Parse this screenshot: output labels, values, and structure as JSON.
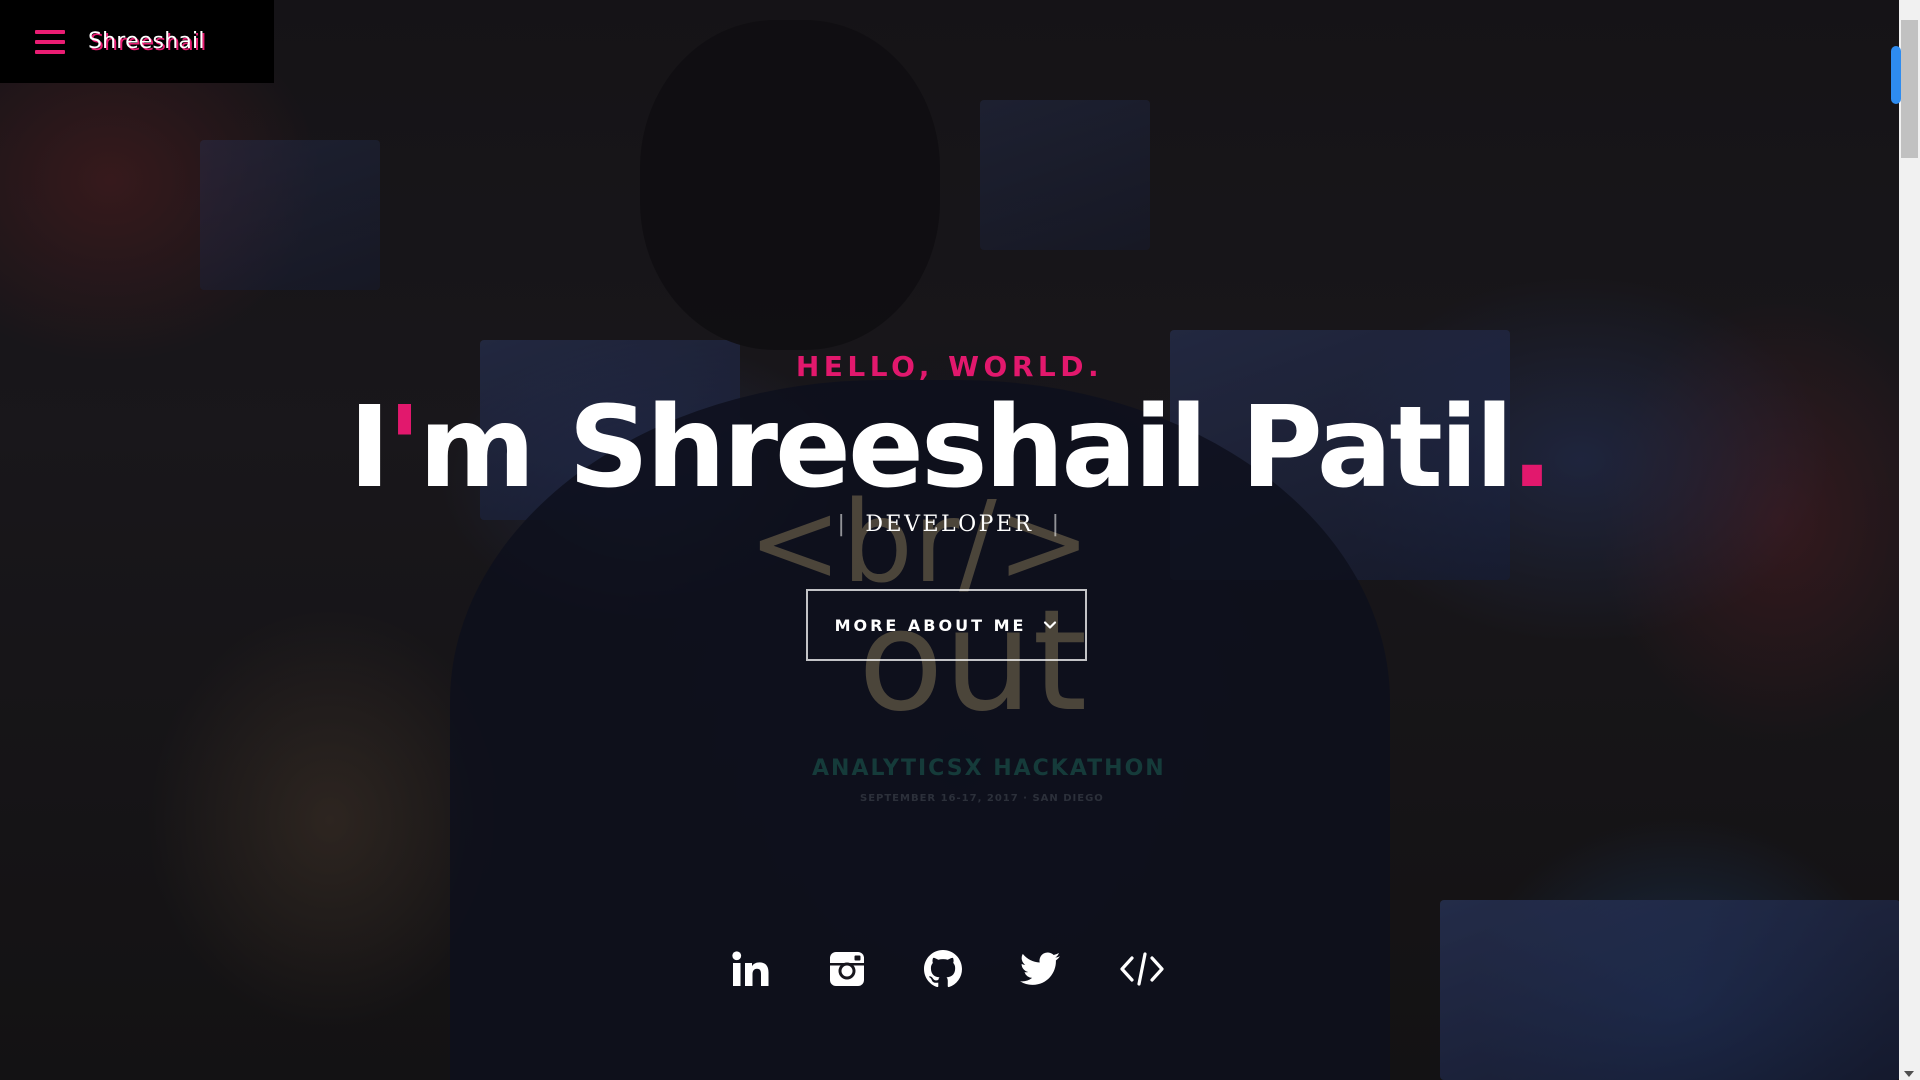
{
  "navbar": {
    "brand": "Shreeshail",
    "menu_icon": "hamburger-menu-icon",
    "accent_color": "#ea1d73"
  },
  "hero": {
    "greeting": "HELLO, WORLD.",
    "name_prefix": "I",
    "name_apostrophe": "'",
    "name_rest": "m Shreeshail Patil",
    "name_dot": ".",
    "role_bar_left": "|",
    "role": "DEVELOPER",
    "role_bar_right": "|",
    "cta_label": "MORE ABOUT ME",
    "cta_icon": "chevron-down-icon"
  },
  "social_links": [
    {
      "name": "linkedin",
      "icon": "linkedin-icon"
    },
    {
      "name": "instagram",
      "icon": "instagram-icon"
    },
    {
      "name": "github",
      "icon": "github-icon"
    },
    {
      "name": "twitter",
      "icon": "twitter-icon"
    },
    {
      "name": "code",
      "icon": "code-icon"
    }
  ],
  "background": {
    "shirt_text_1": "<br/>",
    "shirt_text_2": "out",
    "shirt_text_3": "ANALYTICSX HACKATHON",
    "shirt_text_4": "SEPTEMBER 16-17, 2017 · SAN DIEGO"
  },
  "colors": {
    "accent": "#e2186d",
    "text": "#ffffff",
    "navbar_bg": "#000000",
    "scroll_indicator": "#2e8cf0"
  }
}
